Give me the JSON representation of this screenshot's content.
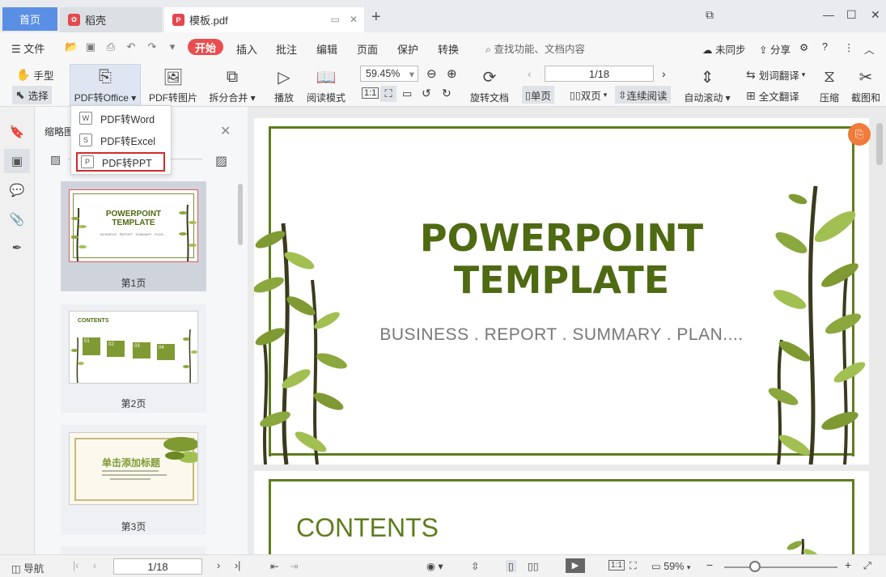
{
  "tabs": {
    "home": "首页",
    "tab1": "稻壳",
    "tab2": "模板.pdf"
  },
  "menu": {
    "file": "文件",
    "items": [
      "开始",
      "插入",
      "批注",
      "编辑",
      "页面",
      "保护",
      "转换"
    ],
    "search_hint": "查找功能、文档内容",
    "sync": "未同步",
    "share": "分享"
  },
  "toolbar": {
    "hand": "手型",
    "select": "选择",
    "pdf_office": "PDF转Office",
    "pdf_image": "PDF转图片",
    "split_merge": "拆分合并",
    "play": "播放",
    "read_mode": "阅读模式",
    "zoom": "59.45%",
    "rotate_doc": "旋转文档",
    "page": "1/18",
    "single": "单页",
    "double": "双页",
    "continuous": "连续阅读",
    "auto_scroll": "自动滚动",
    "word_translate": "划词翻译",
    "full_translate": "全文翻译",
    "compress": "压缩",
    "screenshot": "截图和"
  },
  "dropdown": {
    "items": [
      "PDF转Word",
      "PDF转Excel",
      "PDF转PPT"
    ],
    "highlighted": 2
  },
  "thumbs": {
    "title": "缩略图",
    "pages": [
      {
        "label": "第1页",
        "title1": "POWERPOINT",
        "title2": "TEMPLATE",
        "sub": "BUSINESS . REPORT . SUMMARY . PLAN...."
      },
      {
        "label": "第2页",
        "title1": "CONTENTS",
        "nums": [
          "01",
          "02",
          "03",
          "04"
        ]
      },
      {
        "label": "第3页",
        "title1": "单击添加标题"
      }
    ]
  },
  "doc": {
    "title1": "POWERPOINT",
    "title2": "TEMPLATE",
    "subtitle": "BUSINESS . REPORT . SUMMARY . PLAN....",
    "slide2_title": "CONTENTS"
  },
  "status": {
    "nav": "导航",
    "page": "1/18",
    "zoom": "59%",
    "zoom_percent": 59
  },
  "colors": {
    "accent": "#e84e4e",
    "home_tab": "#5b8fe6",
    "slide_green": "#5e7d1e",
    "highlight_border": "#d22b2b"
  }
}
